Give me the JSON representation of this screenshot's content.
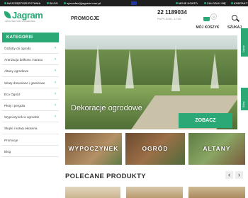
{
  "topbar": {
    "faq": "NAJCZĘSTSZE PYTANIA",
    "blog": "BLOG",
    "email": "sprzedaz@jagram.com.pl",
    "account": "MOJE KONTO",
    "login": "ZALOGUJ SIĘ",
    "contact": "KONTAKT"
  },
  "header": {
    "logo_text": "Jagram",
    "logo_tagline": "ARCHITEKTURA OGRODOWA",
    "promo_link": "PROMOCJE",
    "phone": "22 1189034",
    "hours": "Pn-Pt. 8:00 - 17:00",
    "cart_count": "0",
    "cart_label": "MÓJ KOSZYK",
    "search_label": "SZUKAJ"
  },
  "sidebar": {
    "heading": "KATEGORIE",
    "items": [
      {
        "label": "Ozdoby do ogrodu"
      },
      {
        "label": "Aranżacja balkonu i tarasu"
      },
      {
        "label": "Altany ogrodowe"
      },
      {
        "label": "Wiaty drewniane i garażowe"
      },
      {
        "label": "Eco Ogród"
      },
      {
        "label": "Płoty i pergola"
      },
      {
        "label": "Wypoczynek w ogrodzie"
      },
      {
        "label": "Słupki i kotwy ekosoria"
      },
      {
        "label": "Promocje"
      },
      {
        "label": "Blog"
      }
    ]
  },
  "hero": {
    "caption": "Dekoracje ogrodowe",
    "cta": "ZOBACZ"
  },
  "widgets": {
    "side1": "Opinie",
    "side2": "Sklep"
  },
  "tiles": [
    {
      "label": "WYPOCZYNEK"
    },
    {
      "label": "OGRÓD"
    },
    {
      "label": "ALTANY"
    }
  ],
  "recommended": {
    "title": "POLECANE PRODUKTY"
  },
  "colors": {
    "brand": "#2aa876",
    "topbar": "#1f1f1f"
  }
}
